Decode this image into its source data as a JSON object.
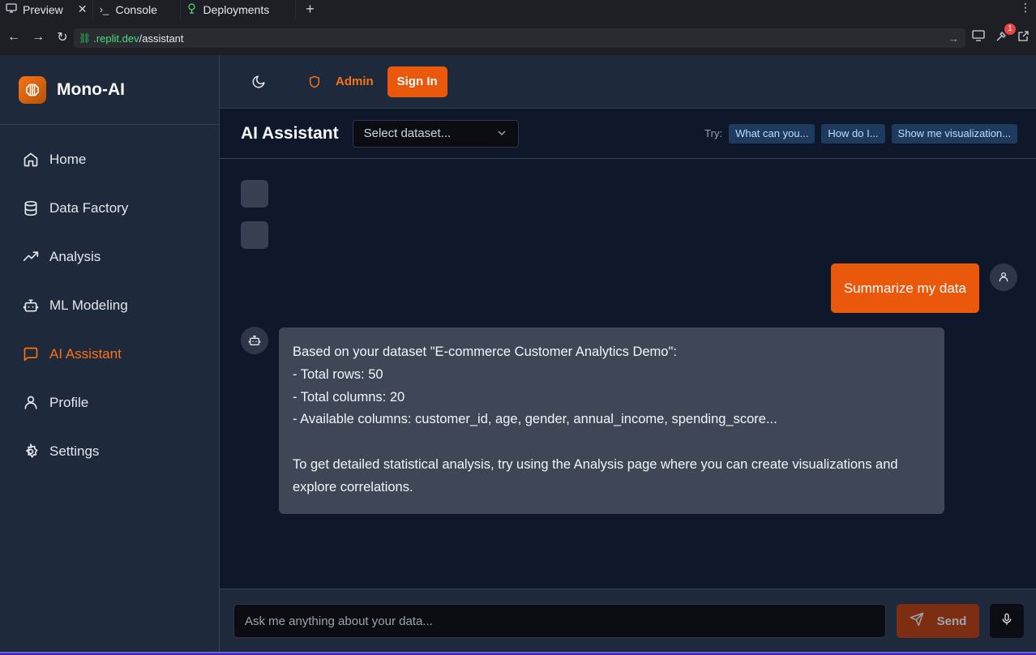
{
  "browser": {
    "tabs": [
      {
        "label": "Preview",
        "icon": "monitor-icon"
      },
      {
        "label": "Console",
        "icon": "terminal-icon"
      },
      {
        "label": "Deployments",
        "icon": "deploy-icon"
      }
    ],
    "url_domain": ".replit.dev",
    "url_path": "/assistant",
    "notification_count": "1"
  },
  "sidebar": {
    "brand": "Mono-AI",
    "items": [
      {
        "label": "Home",
        "icon": "home-icon"
      },
      {
        "label": "Data Factory",
        "icon": "database-icon"
      },
      {
        "label": "Analysis",
        "icon": "trending-up-icon"
      },
      {
        "label": "ML Modeling",
        "icon": "bot-icon"
      },
      {
        "label": "AI Assistant",
        "icon": "message-square-icon",
        "active": true
      },
      {
        "label": "Profile",
        "icon": "user-icon"
      },
      {
        "label": "Settings",
        "icon": "gear-icon"
      }
    ]
  },
  "header": {
    "admin_label": "Admin",
    "signin_label": "Sign In"
  },
  "toolbar": {
    "title": "AI Assistant",
    "dataset_placeholder": "Select dataset...",
    "try_label": "Try:",
    "suggestions": [
      "What can you...",
      "How do I...",
      "Show me visualization..."
    ]
  },
  "chat": {
    "user_message": "Summarize my data",
    "bot_message_lines": [
      "Based on your dataset \"E-commerce Customer Analytics Demo\":",
      "- Total rows: 50",
      "- Total columns: 20",
      "- Available columns: customer_id, age, gender, annual_income, spending_score...",
      "",
      "To get detailed statistical analysis, try using the Analysis page where you can create visualizations and explore correlations."
    ]
  },
  "input": {
    "placeholder": "Ask me anything about your data...",
    "send_label": "Send"
  },
  "colors": {
    "accent": "#ea580c",
    "sidebar_bg": "#1e293b",
    "main_bg": "#0f172a"
  }
}
